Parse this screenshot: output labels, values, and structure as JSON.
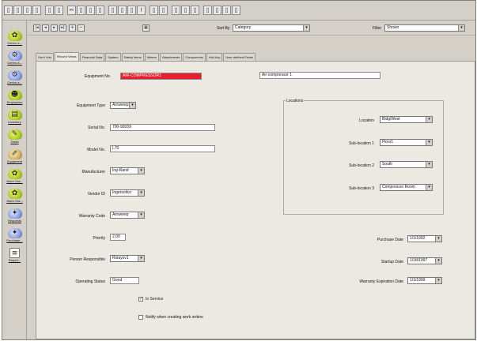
{
  "toolbar": {
    "buttons": [
      "▯",
      "▯",
      "▯",
      "▯",
      "▯",
      "▯",
      "✂",
      "▯",
      "▯",
      "▯",
      "▯",
      "▯",
      "▯",
      "▯",
      "!",
      "▯",
      "▯",
      "▯",
      "▯",
      "▯",
      "▯",
      "▯",
      "▯",
      "▯"
    ]
  },
  "leftbar": {
    "items": [
      {
        "label": "Centro a...",
        "icon": "flower-icon"
      },
      {
        "label": "Centro a...",
        "icon": "gear-icon"
      },
      {
        "label": "Centro a...",
        "icon": "gear-icon"
      },
      {
        "label": "Employees",
        "icon": "group-icon"
      },
      {
        "label": "Inventory",
        "icon": "book-icon"
      },
      {
        "label": "Tasks",
        "icon": "tasks-icon"
      },
      {
        "label": "Equipment",
        "icon": "wrench-icon"
      },
      {
        "label": "Work Ord...",
        "icon": "flower-icon"
      },
      {
        "label": "Work Ord...",
        "icon": "flower-icon"
      },
      {
        "label": "Requests",
        "icon": "request-icon"
      },
      {
        "label": "Purchase...",
        "icon": "cart-icon"
      },
      {
        "label": "Report...",
        "icon": "report-icon"
      }
    ]
  },
  "navbar": {
    "record_buttons": [
      "|◂",
      "◂",
      "▸",
      "▸|",
      "+",
      "−"
    ],
    "sort_label": "Sort By",
    "sort_value": "Category",
    "filter_label": "Filter",
    "filter_value": "Shown"
  },
  "tabs": [
    "Gen'l Info",
    "Record Views",
    "Financial Data",
    "System",
    "Safety Items",
    "Meters",
    "Attachments",
    "Components",
    "Hot-Key",
    "User defined Fields"
  ],
  "form": {
    "equipment_no_label": "Equipment No.",
    "equipment_no_value": "AIR-COMPRESSOR1",
    "description_value": "Air-compressor 1",
    "equipment_type_label": "Equipment Type",
    "equipment_type_value": "Airsweep",
    "serial_no_label": "Serial No.",
    "serial_no_value": "700-9003X",
    "model_no_label": "Model No.",
    "model_no_value": "L70",
    "manufacturer_label": "Manufacturer",
    "manufacturer_value": "Ing-Rand",
    "vendor_label": "Vendor ID",
    "vendor_value": "Ingersollco",
    "warranty_code_label": "Warranty Code",
    "warranty_code_value": "Airsweep",
    "priority_label": "Priority",
    "priority_value": "2.00",
    "person_responsible_label": "Person Responsible",
    "person_responsible_value": "Rstaysv1",
    "operating_status_label": "Operating Status",
    "operating_status_value": "Good",
    "in_service_label": "In Service",
    "notify_label": "Notify when creating work orders",
    "location": {
      "title": "Locations",
      "location_label": "Location",
      "location_value": "Bldg/West",
      "sub1_label": "Sub-location 1",
      "sub1_value": "Floor1",
      "sub2_label": "Sub-location 2",
      "sub2_value": "South",
      "sub3_label": "Sub-location 3",
      "sub3_value": "Compressor Room"
    },
    "purchase_date_label": "Purchase Date",
    "purchase_date_value": "1/1/1992",
    "startup_date_label": "Startup Date",
    "startup_date_value": "1/18/1997",
    "warranty_exp_label": "Warranty Expiration Date",
    "warranty_exp_value": "1/1/1999"
  }
}
